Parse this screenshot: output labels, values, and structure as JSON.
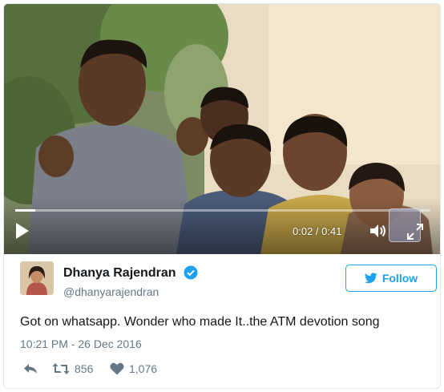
{
  "video": {
    "current_time": "0:02",
    "separator": " / ",
    "total_time": "0:41",
    "progress": 0.049
  },
  "author": {
    "display_name": "Dhanya Rajendran",
    "handle": "@dhanyarajendran",
    "verified": true
  },
  "follow_label": "Follow",
  "tweet": {
    "text": "Got on whatsapp. Wonder who made It..the ATM devotion song",
    "timestamp": "10:21 PM - 26 Dec 2016"
  },
  "actions": {
    "retweets": "856",
    "likes": "1,076"
  },
  "colors": {
    "brand_blue": "#1da1f2",
    "secondary_text": "#657786",
    "primary_text": "#14171a",
    "border": "#e1e8ed"
  },
  "icons": [
    "play-icon",
    "volume-icon",
    "fullscreen-icon",
    "verified-badge-icon",
    "twitter-bird-icon",
    "reply-icon",
    "retweet-icon",
    "heart-icon"
  ]
}
